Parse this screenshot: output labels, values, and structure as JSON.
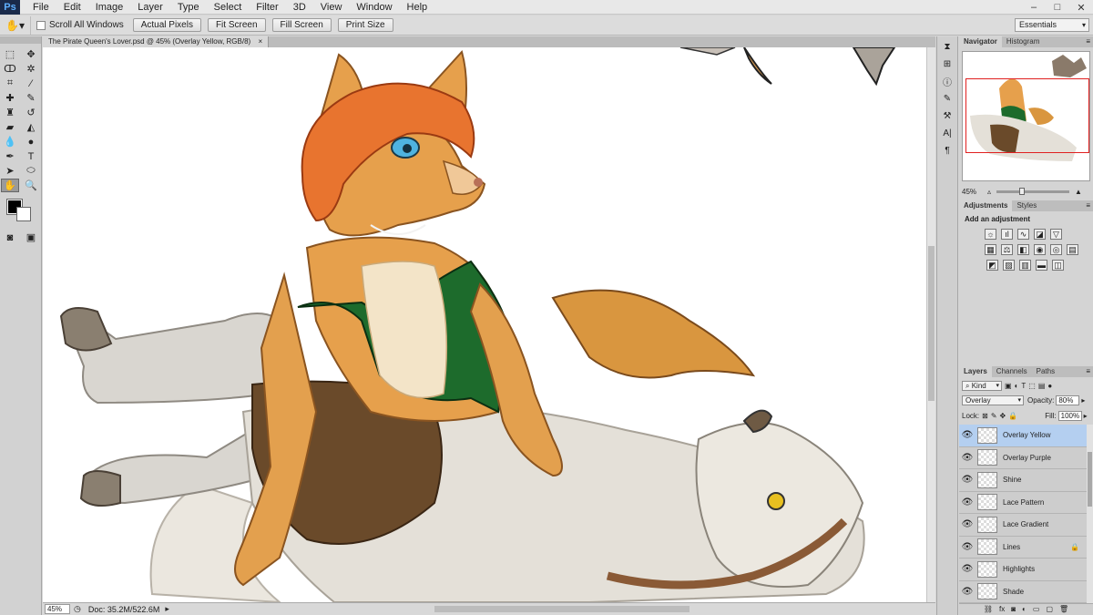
{
  "app": {
    "logo": "Ps"
  },
  "menu": [
    "File",
    "Edit",
    "Image",
    "Layer",
    "Type",
    "Select",
    "Filter",
    "3D",
    "View",
    "Window",
    "Help"
  ],
  "window_controls": [
    "–",
    "□",
    "✕"
  ],
  "options_bar": {
    "tool_icon": "hand-icon",
    "scroll_all_windows": "Scroll All Windows",
    "buttons": [
      "Actual Pixels",
      "Fit Screen",
      "Fill Screen",
      "Print Size"
    ],
    "workspace": "Essentials"
  },
  "document": {
    "tab_title": "The Pirate Queen's Lover.psd @ 45% (Overlay Yellow, RGB/8)",
    "zoom": "45%",
    "doc_size": "Doc: 35.2M/522.6M"
  },
  "panels": {
    "navigator_tabs": [
      "Navigator",
      "Histogram"
    ],
    "navigator_zoom": "45%",
    "adjust_tabs": [
      "Adjustments",
      "Styles"
    ],
    "adjust_title": "Add an adjustment",
    "layers_tabs": [
      "Layers",
      "Channels",
      "Paths"
    ],
    "kind_label": "Kind",
    "blend_mode": "Overlay",
    "opacity_label": "Opacity:",
    "opacity_value": "80%",
    "lock_label": "Lock:",
    "fill_label": "Fill:",
    "fill_value": "100%"
  },
  "layers": [
    {
      "name": "Overlay Yellow",
      "selected": true,
      "locked": false
    },
    {
      "name": "Overlay Purple",
      "selected": false,
      "locked": false
    },
    {
      "name": "Shine",
      "selected": false,
      "locked": false
    },
    {
      "name": "Lace Pattern",
      "selected": false,
      "locked": false
    },
    {
      "name": "Lace Gradient",
      "selected": false,
      "locked": false
    },
    {
      "name": "Lines",
      "selected": false,
      "locked": true
    },
    {
      "name": "Highlights",
      "selected": false,
      "locked": false
    },
    {
      "name": "Shade",
      "selected": false,
      "locked": false
    }
  ],
  "colors": {
    "fox_fur": "#e09a45",
    "hair": "#e8742f",
    "dress": "#1d6b2c",
    "wolf_fur": "#e4e0d8",
    "shorts": "#6a4a2a",
    "selection": "#b4cff0"
  }
}
